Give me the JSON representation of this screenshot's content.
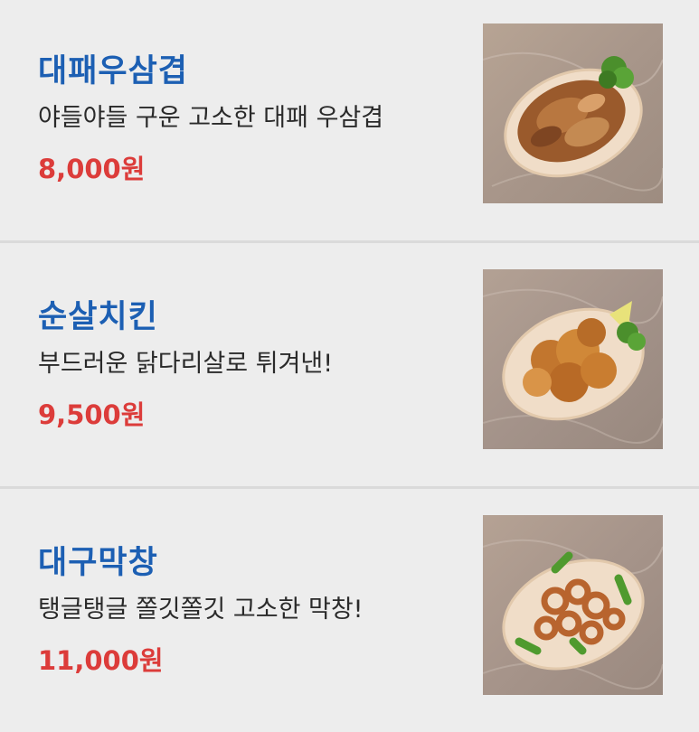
{
  "items": [
    {
      "name": "대패우삼겹",
      "description": "야들야들 구운 고소한 대패 우삼겹",
      "price": "8,000원",
      "image_icon": "thin-sliced-beef-photo"
    },
    {
      "name": "순살치킨",
      "description": "부드러운 닭다리살로 튀겨낸!",
      "price": "9,500원",
      "image_icon": "boneless-chicken-photo"
    },
    {
      "name": "대구막창",
      "description": "탱글탱글 쫄깃쫄깃 고소한 막창!",
      "price": "11,000원",
      "image_icon": "daegu-makchang-photo"
    }
  ],
  "colors": {
    "name": "#1c5fb3",
    "price": "#dc3c3a",
    "description": "#2a2a2a",
    "background": "#ededed",
    "divider": "#dadada"
  }
}
